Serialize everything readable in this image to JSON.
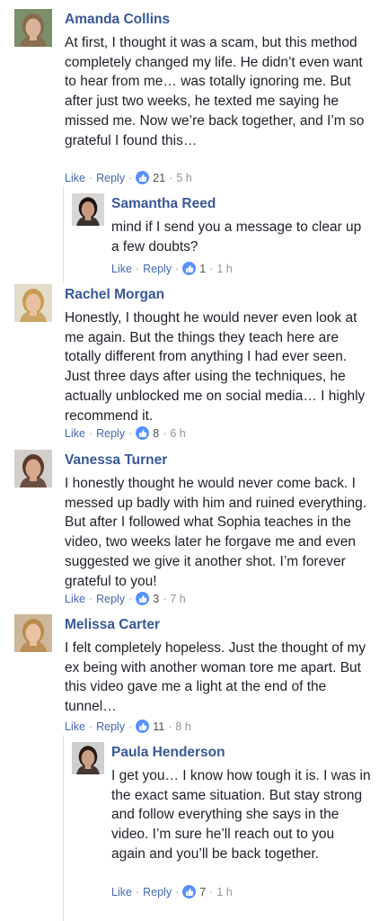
{
  "comments": [
    {
      "id": "c1",
      "name": "Amanda Collins",
      "text": "At first, I thought it was a scam, but this method completely changed my life. He didn’t even want to hear from me… was totally ignoring me. But after just two weeks, he texted me saying he missed me. Now we’re back together, and I’m so grateful I found this…",
      "like_label": "Like",
      "reply_label": "Reply",
      "likes": "21",
      "time": "5 h",
      "avatar": {
        "bg": "#7a8f6a",
        "skin": "#d9b49a",
        "hair": "#8a6a4a"
      }
    },
    {
      "id": "c1r1",
      "name": "Samantha Reed",
      "text": "mind if I send you a message to clear up a few doubts?",
      "like_label": "Like",
      "reply_label": "Reply",
      "likes": "1",
      "time": "1 h",
      "avatar": {
        "bg": "#d8d6d2",
        "skin": "#c79a80",
        "hair": "#1c1412"
      }
    },
    {
      "id": "c2",
      "name": "Rachel Morgan",
      "text": "Honestly, I thought he would never even look at me again. But the things they teach here are totally different from anything I had ever seen. Just three days after using the techniques, he actually unblocked me on social media… I highly recommend it.",
      "like_label": "Like",
      "reply_label": "Reply",
      "likes": "8",
      "time": "6 h",
      "avatar": {
        "bg": "#e3dcc8",
        "skin": "#e6c0a0",
        "hair": "#c89a52"
      }
    },
    {
      "id": "c3",
      "name": "Vanessa Turner",
      "text": "I honestly thought he would never come back. I messed up badly with him and ruined everything. But after I followed what Sophia teaches in the video, two weeks later he forgave me and even suggested we give it another shot. I’m forever grateful to you!",
      "like_label": "Like",
      "reply_label": "Reply",
      "likes": "3",
      "time": "7 h",
      "avatar": {
        "bg": "#d2cfcb",
        "skin": "#d6a98e",
        "hair": "#5a3a2a"
      }
    },
    {
      "id": "c4",
      "name": "Melissa Carter",
      "text": "I felt completely hopeless. Just the thought of my ex being with another woman tore me apart. But this video gave me a light at the end of the tunnel…",
      "like_label": "Like",
      "reply_label": "Reply",
      "likes": "11",
      "time": "8 h",
      "avatar": {
        "bg": "#cdb79a",
        "skin": "#e8c2a2",
        "hair": "#b98a4a"
      }
    },
    {
      "id": "c4r1",
      "name": "Paula Henderson",
      "text": "I get you… I know how tough it is. I was in the exact same situation. But stay strong and follow everything she says in the video. I’m sure he’ll reach out to you again and you’ll be back together.",
      "like_label": "Like",
      "reply_label": "Reply",
      "likes": "7",
      "time": "1 h",
      "avatar": {
        "bg": "#cfcfcf",
        "skin": "#caa084",
        "hair": "#2a1a14"
      }
    }
  ],
  "colors": {
    "name": "#385898",
    "link": "#4267b2",
    "meta": "#90949c",
    "like_badge": "#5890ff"
  }
}
